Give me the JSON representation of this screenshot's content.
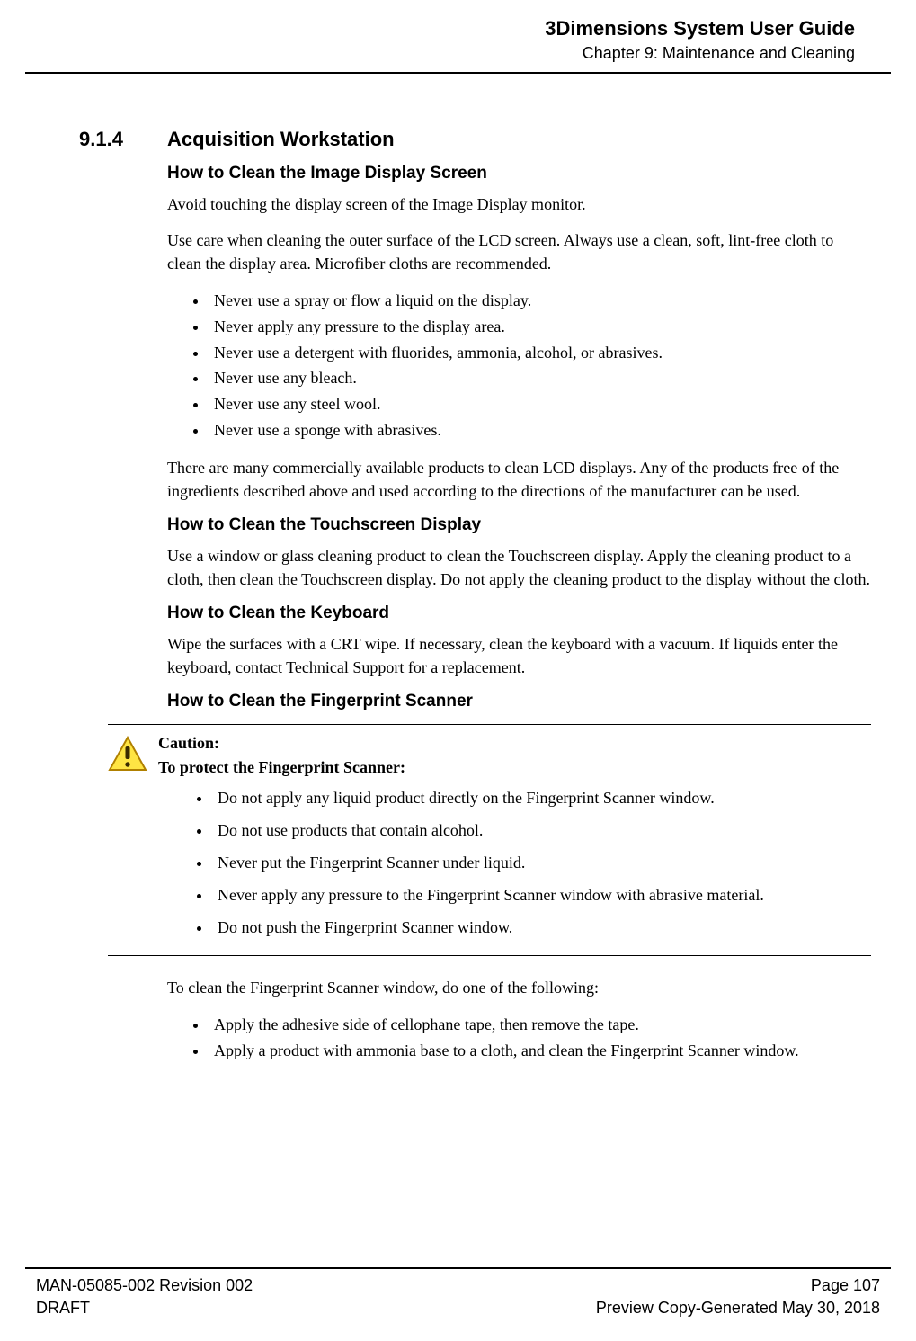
{
  "header": {
    "title": "3Dimensions System User Guide",
    "chapter": "Chapter 9: Maintenance and Cleaning"
  },
  "section": {
    "number": "9.1.4",
    "title": "Acquisition Workstation"
  },
  "sub1": {
    "heading": "How to Clean the Image Display Screen",
    "p1": "Avoid touching the display screen of the Image Display monitor.",
    "p2": "Use care when cleaning the outer surface of the LCD screen. Always use a clean, soft, lint-free cloth to clean the display area. Microfiber cloths are recommended.",
    "bullets": [
      "Never use a spray or flow a liquid on the display.",
      "Never apply any pressure to the display area.",
      "Never use a detergent with fluorides, ammonia, alcohol, or abrasives.",
      "Never use any bleach.",
      "Never use any steel wool.",
      "Never use a sponge with abrasives."
    ],
    "p3": "There are many commercially available products to clean LCD displays. Any of the products free of the ingredients described above and used according to the directions of the manufacturer can be used."
  },
  "sub2": {
    "heading": "How to Clean the Touchscreen Display",
    "p1": "Use a window or glass cleaning product to clean the Touchscreen display. Apply the cleaning product to a cloth, then clean the Touchscreen display. Do not apply the cleaning product to the display without the cloth."
  },
  "sub3": {
    "heading": "How to Clean the Keyboard",
    "p1": "Wipe the surfaces with a CRT wipe. If necessary, clean the keyboard with a vacuum. If liquids enter the keyboard, contact Technical Support for a replacement."
  },
  "sub4": {
    "heading": "How to Clean the Fingerprint Scanner",
    "caution": {
      "label": "Caution:",
      "subtitle": "To protect the Fingerprint Scanner:",
      "bullets": [
        "Do not apply any liquid product directly on the Fingerprint Scanner window.",
        "Do not use products that contain alcohol.",
        "Never put the Fingerprint Scanner under liquid.",
        "Never apply any pressure to the Fingerprint Scanner window with abrasive material.",
        "Do not push the Fingerprint Scanner window."
      ]
    },
    "p1": "To clean the Fingerprint Scanner window, do one of the following:",
    "bullets": [
      "Apply the adhesive side of cellophane tape, then remove the tape.",
      "Apply a product with ammonia base to a cloth, and clean the Fingerprint Scanner window."
    ]
  },
  "footer": {
    "left1": "MAN-05085-002 Revision 002",
    "left2": "DRAFT",
    "right1": "Page 107",
    "right2": "Preview Copy-Generated May 30, 2018"
  }
}
